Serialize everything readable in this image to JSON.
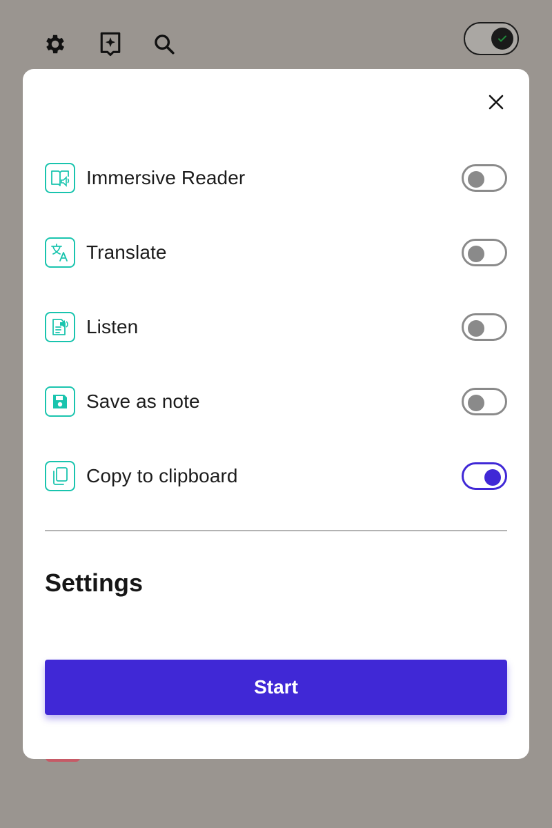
{
  "toolbar": {
    "icons": [
      "gear-icon",
      "sparkle-bookmark-icon",
      "search-icon"
    ],
    "main_toggle": {
      "state": "on",
      "knob_icon": "check-icon"
    }
  },
  "modal": {
    "close_icon": "close-icon",
    "options": [
      {
        "label": "Immersive Reader",
        "icon": "immersive-reader-icon",
        "enabled": false
      },
      {
        "label": "Translate",
        "icon": "translate-icon",
        "enabled": false
      },
      {
        "label": "Listen",
        "icon": "listen-icon",
        "enabled": false
      },
      {
        "label": "Save as note",
        "icon": "save-icon",
        "enabled": false
      },
      {
        "label": "Copy to clipboard",
        "icon": "copy-icon",
        "enabled": true
      }
    ],
    "settings_heading": "Settings",
    "start_button": "Start"
  },
  "colors": {
    "accent": "#4028d6",
    "icon_teal": "#19c4ae",
    "toggle_off": "#8a8a8a",
    "backdrop": "#9a9590"
  }
}
